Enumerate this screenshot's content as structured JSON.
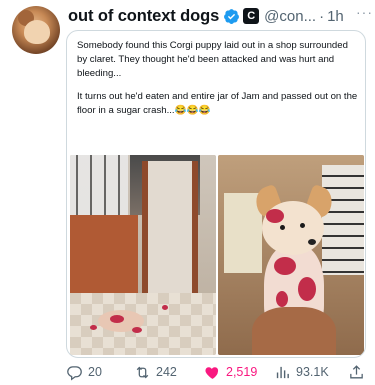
{
  "account": {
    "display_name": "out of context dogs",
    "handle": "@con...",
    "separator": "·",
    "time": "1h",
    "badge_letter": "C"
  },
  "more_label": "···",
  "card": {
    "paragraph1": "Somebody found this Corgi puppy laid out in a shop surrounded by claret. They thought he'd been attacked and was hurt and bleeding...",
    "paragraph2": "It turns out he'd eaten and entire jar of Jam and passed out on the floor in a sugar crash...😂😂😂"
  },
  "actions": {
    "replies": "20",
    "reposts": "242",
    "likes": "2,519",
    "views": "93.1K"
  },
  "colors": {
    "like": "#f91880",
    "verified": "#1d9bf0",
    "muted": "#536471"
  }
}
